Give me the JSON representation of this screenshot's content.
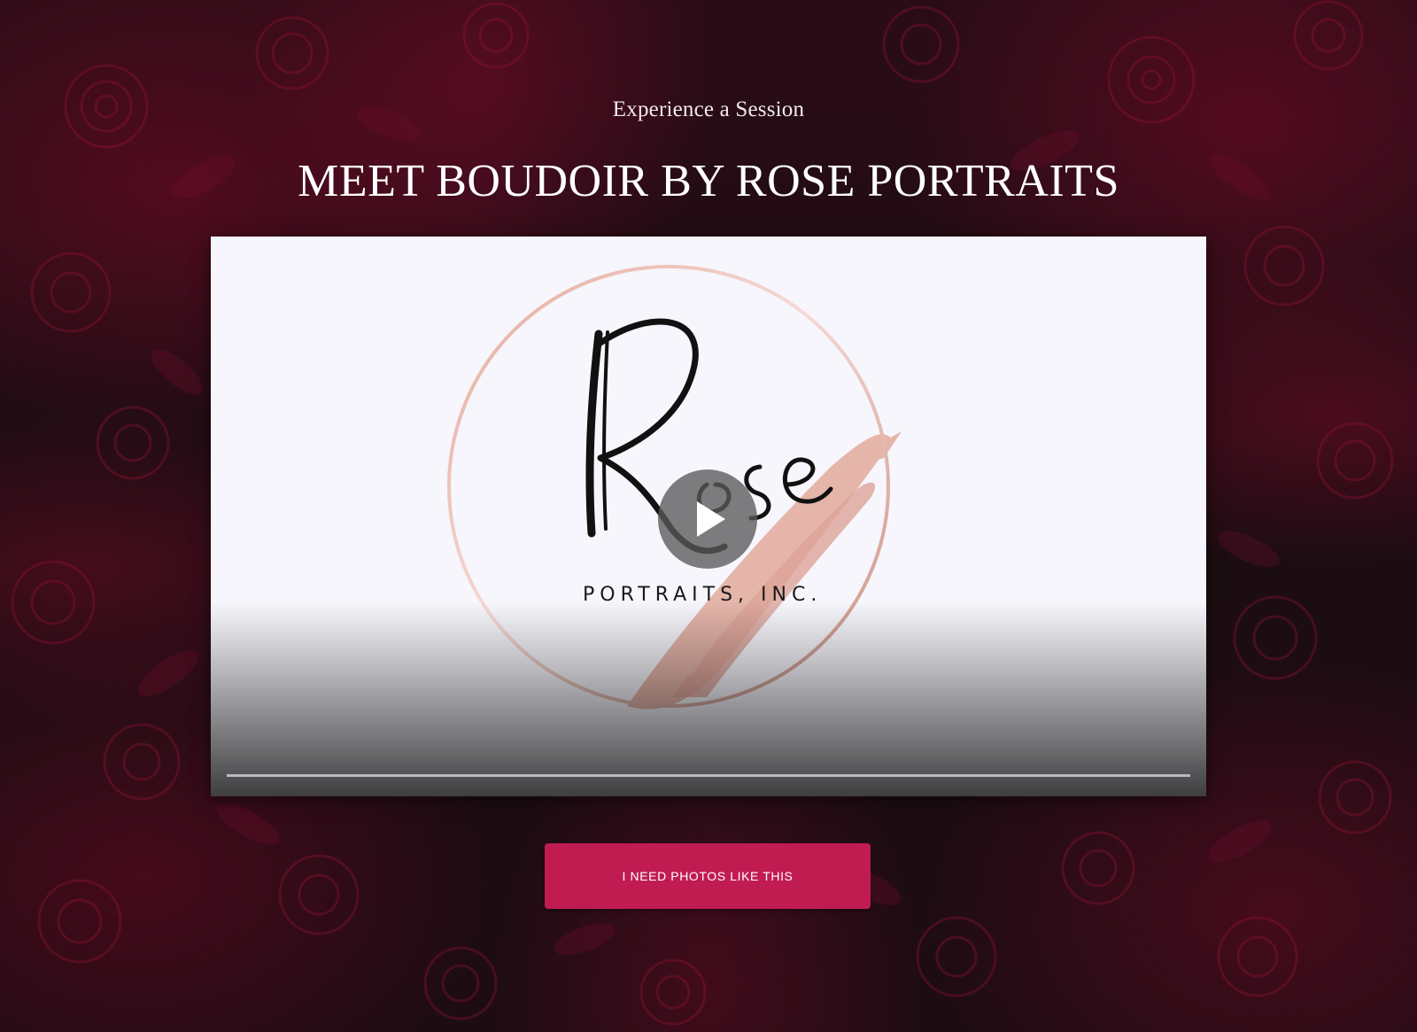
{
  "section": {
    "eyebrow": "Experience a Session",
    "headline": "MEET BOUDOIR BY ROSE PORTRAITS"
  },
  "video": {
    "logo": {
      "script_text": "Rose",
      "subtitle": "PORTRAITS, INC."
    },
    "play_icon": "play-icon",
    "progress_fraction": 0
  },
  "cta": {
    "label": "I NEED PHOTOS LIKE THIS"
  },
  "colors": {
    "accent": "#c11c52",
    "background": "#1b0d12",
    "rose_stroke": "#e8b8ad"
  }
}
